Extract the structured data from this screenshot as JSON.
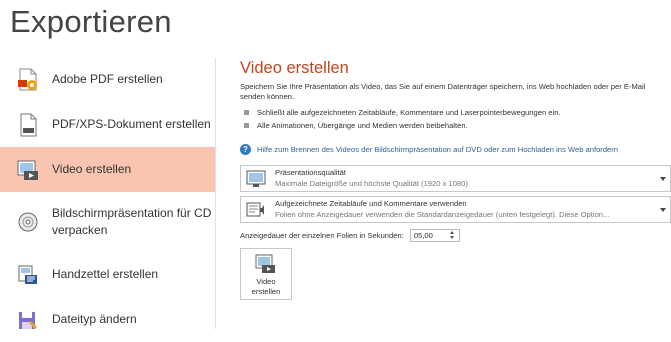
{
  "page": {
    "title": "Exportieren"
  },
  "sidebar": {
    "items": [
      {
        "label": "Adobe PDF erstellen",
        "icon": "adobe-pdf-icon"
      },
      {
        "label": "PDF/XPS-Dokument erstellen",
        "icon": "pdf-xps-document-icon"
      },
      {
        "label": "Video erstellen",
        "icon": "video-icon",
        "active": true
      },
      {
        "label": "Bildschirmpräsentation für CD verpacken",
        "icon": "cd-package-icon"
      },
      {
        "label": "Handzettel erstellen",
        "icon": "handout-icon"
      },
      {
        "label": "Dateityp ändern",
        "icon": "change-filetype-icon"
      }
    ]
  },
  "main": {
    "title": "Video erstellen",
    "description": "Speichern Sie Ihre Präsentation als Video, das Sie auf einem Datenträger speichern, ins Web hochladen oder per E-Mail senden können.",
    "bullets": [
      "Schließt alle aufgezeichneten Zeitabläufe, Kommentare und Laserpointerbewegungen ein.",
      "Alle Animationen, Übergänge und Medien werden beibehalten."
    ],
    "help_link": "Hilfe zum Brennen des Videos der Bildschirmpräsentation auf DVD oder zum Hochladen ins Web anfordern",
    "quality_dropdown": {
      "title": "Präsentationsqualität",
      "subtitle": "Maximale Dateigröße und höchste Qualität (1920 x 1080)"
    },
    "timing_dropdown": {
      "title": "Aufgezeichnete Zeitabläufe und Kommentare verwenden",
      "subtitle": "Folien ohne Anzeigedauer verwenden die Standardanzeigedauer (unten festgelegt). Diese Option..."
    },
    "duration_label": "Anzeigedauer der einzelnen Folien in Sekunden:",
    "duration_value": "05,00",
    "create_button": {
      "line1": "Video",
      "line2": "erstellen"
    }
  },
  "colors": {
    "accent": "#c0461f",
    "active_bg": "#f9c5b0",
    "link": "#2f5fa1"
  }
}
